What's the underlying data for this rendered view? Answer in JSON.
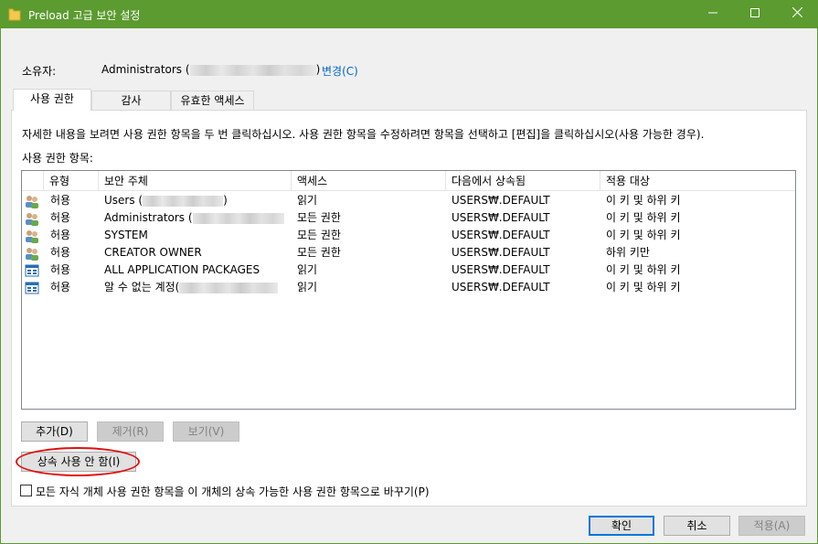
{
  "window": {
    "title": "Preload 고급 보안 설정",
    "minimize_glyph": "—",
    "maximize_glyph": "☐",
    "close_glyph": "✕"
  },
  "owner": {
    "label": "소유자:",
    "name": "Administrators (",
    "name_suffix": ")",
    "change_link": "변경(C)"
  },
  "tabs": [
    {
      "label": "사용 권한",
      "active": true
    },
    {
      "label": "감사",
      "active": false
    },
    {
      "label": "유효한 액세스",
      "active": false
    }
  ],
  "instructions": "자세한 내용을 보려면 사용 권한 항목을 두 번 클릭하십시오. 사용 권한 항목을 수정하려면 항목을 선택하고 [편집]을 클릭하십시오(사용 가능한 경우).",
  "entries_label": "사용 권한 항목:",
  "columns": [
    "유형",
    "보안 주체",
    "액세스",
    "다음에서 상속됨",
    "적용 대상"
  ],
  "rows": [
    {
      "icon": "users-group-icon",
      "type": "허용",
      "principal": "Users (",
      "principal_suffix": ")",
      "access": "읽기",
      "inherited": "USERS₩.DEFAULT",
      "applies": "이 키 및 하위 키"
    },
    {
      "icon": "users-group-icon",
      "type": "허용",
      "principal": "Administrators (",
      "principal_suffix": "",
      "access": "모든 권한",
      "inherited": "USERS₩.DEFAULT",
      "applies": "이 키 및 하위 키"
    },
    {
      "icon": "users-group-icon",
      "type": "허용",
      "principal": "SYSTEM",
      "principal_suffix": "",
      "access": "모든 권한",
      "inherited": "USERS₩.DEFAULT",
      "applies": "이 키 및 하위 키"
    },
    {
      "icon": "users-group-icon",
      "type": "허용",
      "principal": "CREATOR OWNER",
      "principal_suffix": "",
      "access": "모든 권한",
      "inherited": "USERS₩.DEFAULT",
      "applies": "하위 키만"
    },
    {
      "icon": "app-package-icon",
      "type": "허용",
      "principal": "ALL APPLICATION PACKAGES",
      "principal_suffix": "",
      "access": "읽기",
      "inherited": "USERS₩.DEFAULT",
      "applies": "이 키 및 하위 키"
    },
    {
      "icon": "app-package-icon",
      "type": "허용",
      "principal": "알 수 없는 계정(",
      "principal_suffix": "",
      "access": "읽기",
      "inherited": "USERS₩.DEFAULT",
      "applies": "이 키 및 하위 키"
    }
  ],
  "buttons": {
    "add": "추가(D)",
    "remove": "제거(R)",
    "view": "보기(V)",
    "disable_inheritance": "상속 사용 안 함(I)",
    "ok": "확인",
    "cancel": "취소",
    "apply": "적용(A)"
  },
  "replace_checkbox": {
    "label": "모든 자식 개체 사용 권한 항목을 이 개체의 상속 가능한 사용 권한 항목으로 바꾸기(P)",
    "checked": false
  },
  "colors": {
    "titlebar": "#5b9b2f",
    "link": "#0066cc",
    "highlight_ellipse": "#e01010",
    "primary_border": "#0078d7"
  }
}
